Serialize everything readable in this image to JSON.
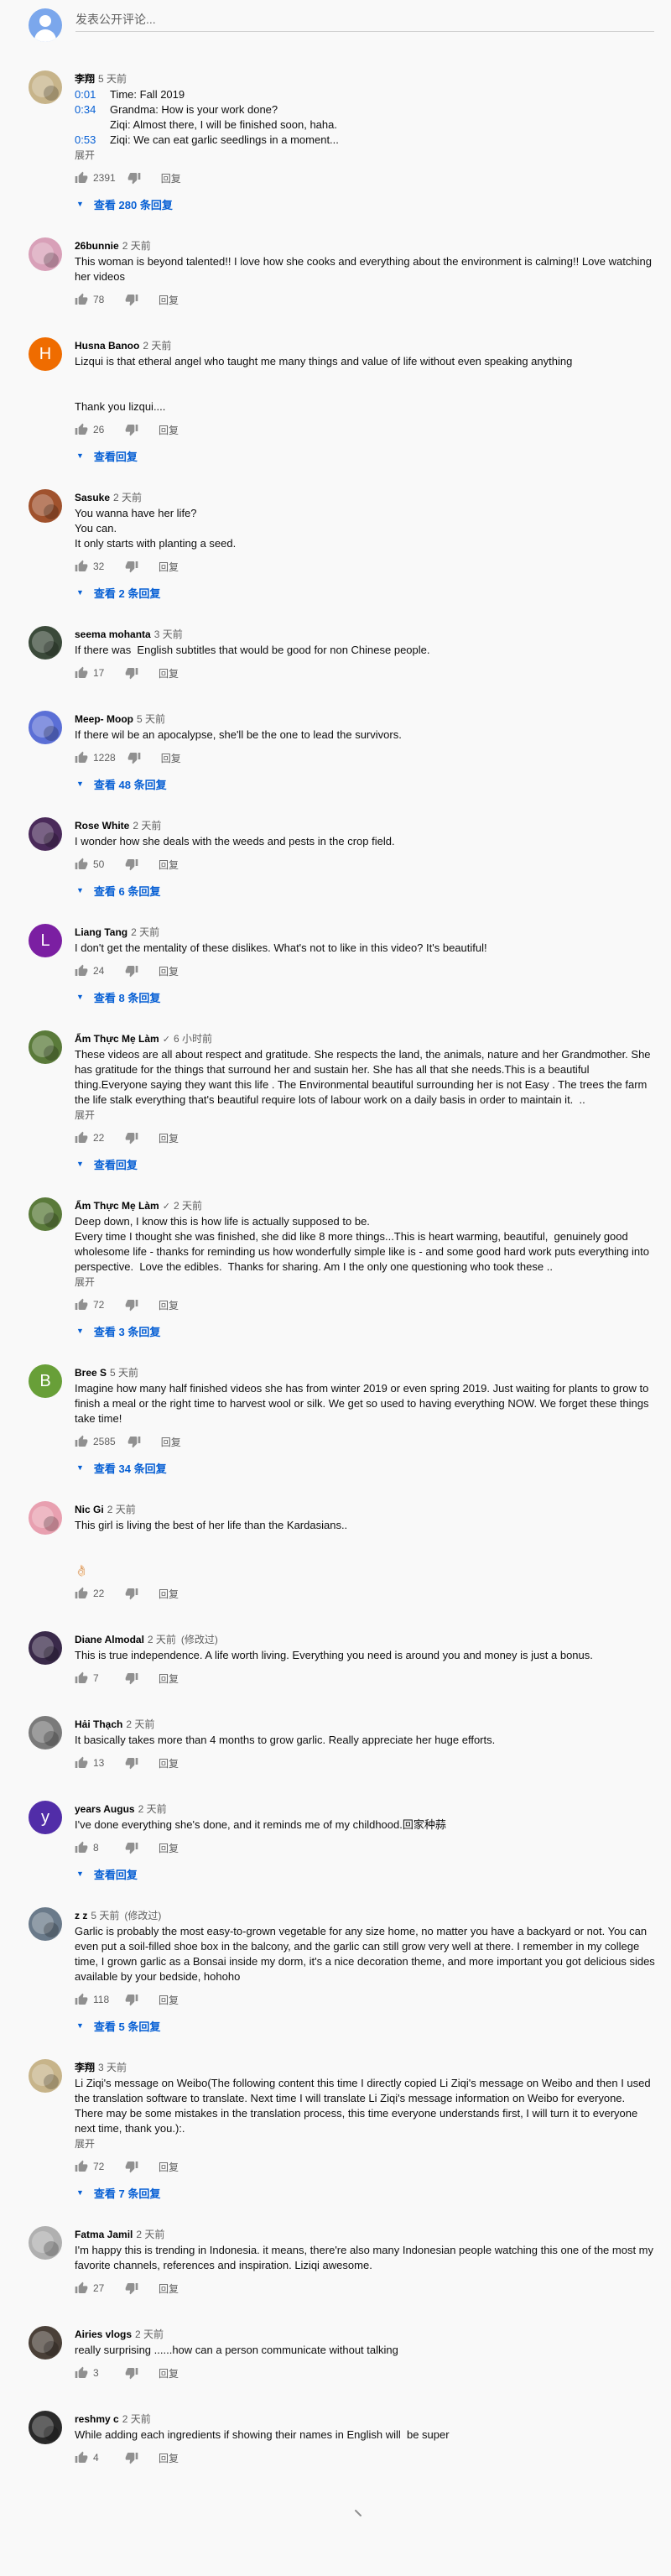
{
  "composer": {
    "placeholder": "发表公开评论..."
  },
  "labels": {
    "reply": "回复",
    "show_more": "展开"
  },
  "comments": [
    {
      "author": "李翔",
      "time": "5 天前",
      "lines": [
        {
          "ts": "0:01",
          "text": "Time: Fall 2019"
        },
        {
          "ts": "0:34",
          "text": "Grandma: How is your work done?"
        },
        {
          "ts": "",
          "text": "Ziqi: Almost there, I will be finished soon, haha."
        },
        {
          "ts": "0:53",
          "text": "Ziqi: We can eat garlic seedlings in a moment..."
        }
      ],
      "show_more": true,
      "likes": "2391",
      "replies": "查看 280 条回复",
      "avatar": "#c7b48a"
    },
    {
      "author": "26bunnie",
      "time": "2 天前",
      "lines": [
        {
          "ts": "",
          "text": "This woman is beyond talented!! I love how she cooks and everything about the environment is calming!! Love watching her videos"
        }
      ],
      "likes": "78",
      "avatar": "#d8a0b8"
    },
    {
      "author": "Husna Banoo",
      "time": "2 天前",
      "lines": [
        {
          "ts": "",
          "text": "Lizqui is that etheral angel who taught me many things and value of life without even speaking anything"
        },
        {
          "ts": "",
          "text": " "
        },
        {
          "ts": "",
          "text": " "
        },
        {
          "ts": "",
          "text": "Thank you lizqui...."
        }
      ],
      "likes": "26",
      "replies": "查看回复",
      "letter": "H",
      "avatar": "#ef6c00"
    },
    {
      "author": "Sasuke",
      "time": "2 天前",
      "lines": [
        {
          "ts": "",
          "text": "You wanna have her life?"
        },
        {
          "ts": "",
          "text": "You can."
        },
        {
          "ts": "",
          "text": "It only starts with planting a seed."
        }
      ],
      "likes": "32",
      "replies": "查看 2 条回复",
      "avatar": "#a0522d"
    },
    {
      "author": "seema mohanta",
      "time": "3 天前",
      "lines": [
        {
          "ts": "",
          "text": "If there was  English subtitles that would be good for non Chinese people."
        }
      ],
      "likes": "17",
      "avatar": "#3b4a3a"
    },
    {
      "author": "Meep- Moop",
      "time": "5 天前",
      "lines": [
        {
          "ts": "",
          "text": "If there wil be an apocalypse, she'll be the one to lead the survivors."
        }
      ],
      "likes": "1228",
      "replies": "查看 48 条回复",
      "avatar": "#5b6fd6"
    },
    {
      "author": "Rose White",
      "time": "2 天前",
      "lines": [
        {
          "ts": "",
          "text": "I wonder how she deals with the weeds and pests in the crop field."
        }
      ],
      "likes": "50",
      "replies": "查看 6 条回复",
      "avatar": "#4a2a5a"
    },
    {
      "author": "Liang Tang",
      "time": "2 天前",
      "lines": [
        {
          "ts": "",
          "text": "I don't get the mentality of these dislikes. What's not to like in this video? It's beautiful!"
        }
      ],
      "likes": "24",
      "replies": "查看 8 条回复",
      "letter": "L",
      "avatar": "#7b1fa2"
    },
    {
      "author": "Ẩm Thực Mẹ Làm",
      "verified": "✓",
      "time": "6 小时前",
      "lines": [
        {
          "ts": "",
          "text": "These videos are all about respect and gratitude. She respects the land, the animals, nature and her Grandmother. She has gratitude for the things that surround her and sustain her. She has all that she needs.This is a beautiful thing.Everyone saying they want this life . The Environmental beautiful surrounding her is not Easy . The trees the farm the life stalk everything that's beautiful require lots of labour work on a daily basis in order to maintain it.  .."
        }
      ],
      "show_more": true,
      "likes": "22",
      "replies": "查看回复",
      "avatar": "#5a7a3a"
    },
    {
      "author": "Ẩm Thực Mẹ Làm",
      "verified": "✓",
      "time": "2 天前",
      "lines": [
        {
          "ts": "",
          "text": "Deep down, I know this is how life is actually supposed to be."
        },
        {
          "ts": "",
          "text": "Every time I thought she was finished, she did like 8 more things...This is heart warming, beautiful,  genuinely good wholesome life - thanks for reminding us how wonderfully simple like is - and some good hard work puts everything into perspective.  Love the edibles.  Thanks for sharing. Am I the only one questioning who took these .."
        }
      ],
      "show_more": true,
      "likes": "72",
      "replies": "查看 3 条回复",
      "avatar": "#5a7a3a"
    },
    {
      "author": "Bree S",
      "time": "5 天前",
      "lines": [
        {
          "ts": "",
          "text": "Imagine how many half finished videos she has from winter 2019 or even spring 2019. Just waiting for plants to grow to finish a meal or the right time to harvest wool or silk. We get so used to having everything NOW. We forget these things take time!"
        }
      ],
      "likes": "2585",
      "replies": "查看 34 条回复",
      "letter": "B",
      "avatar": "#689f38"
    },
    {
      "author": "Nic Gi",
      "time": "2 天前",
      "lines": [
        {
          "ts": "",
          "text": "This girl is living the best of her life than the Kardasians.."
        },
        {
          "ts": "",
          "text": " "
        },
        {
          "ts": "",
          "text": " "
        },
        {
          "ts": "",
          "text": "👌🏻"
        }
      ],
      "likes": "22",
      "avatar": "#e8a0b0"
    },
    {
      "author": "Diane Almodal",
      "time": "2 天前",
      "edited": "(修改过)",
      "lines": [
        {
          "ts": "",
          "text": "This is true independence. A life worth living. Everything you need is around you and money is just a bonus."
        }
      ],
      "likes": "7",
      "avatar": "#3a2a4a"
    },
    {
      "author": "Hải Thạch",
      "time": "2 天前",
      "lines": [
        {
          "ts": "",
          "text": "It basically takes more than 4 months to grow garlic. Really appreciate her huge efforts."
        }
      ],
      "likes": "13",
      "avatar": "#7a7a7a"
    },
    {
      "author": "years Augus",
      "time": "2 天前",
      "lines": [
        {
          "ts": "",
          "text": "I've done everything she's done, and it reminds me of my childhood.回家种蒜"
        }
      ],
      "likes": "8",
      "replies": "查看回复",
      "letter": "y",
      "avatar": "#512da8"
    },
    {
      "author": "z z",
      "time": "5 天前",
      "edited": "(修改过)",
      "lines": [
        {
          "ts": "",
          "text": "Garlic is probably the most easy-to-grown vegetable for any size home, no matter you have a backyard or not. You can even put a soil-filled shoe box in the balcony, and the garlic can still grow very well at there. I remember in my college time, I grown garlic as a Bonsai inside my dorm, it's a nice decoration theme, and more important you got delicious sides available by your bedside, hohoho"
        }
      ],
      "likes": "118",
      "replies": "查看 5 条回复",
      "avatar": "#6a7a8a"
    },
    {
      "author": "李翔",
      "time": "3 天前",
      "lines": [
        {
          "ts": "",
          "text": "Li Ziqi's message on Weibo(The following content this time I directly copied Li Ziqi's message on Weibo and then I used the translation software to translate. Next time I will translate Li Ziqi's message information on Weibo for everyone. There may be some mistakes in the translation process, this time everyone understands first, I will turn it to everyone next time, thank you.):."
        }
      ],
      "show_more": true,
      "likes": "72",
      "replies": "查看 7 条回复",
      "avatar": "#c7b48a"
    },
    {
      "author": "Fatma Jamil",
      "time": "2 天前",
      "lines": [
        {
          "ts": "",
          "text": "I'm happy this is trending in Indonesia. it means, there're also many Indonesian people watching this one of the most my favorite channels, references and inspiration. Liziqi awesome."
        }
      ],
      "likes": "27",
      "avatar": "#b0b0b0"
    },
    {
      "author": "Airies vlogs",
      "time": "2 天前",
      "lines": [
        {
          "ts": "",
          "text": "really surprising ......how can a person communicate without talking"
        }
      ],
      "likes": "3",
      "avatar": "#4a4038"
    },
    {
      "author": "reshmy c",
      "time": "2 天前",
      "lines": [
        {
          "ts": "",
          "text": "While adding each ingredients if showing their names in English will  be super"
        }
      ],
      "likes": "4",
      "avatar": "#2a2a2a"
    }
  ]
}
